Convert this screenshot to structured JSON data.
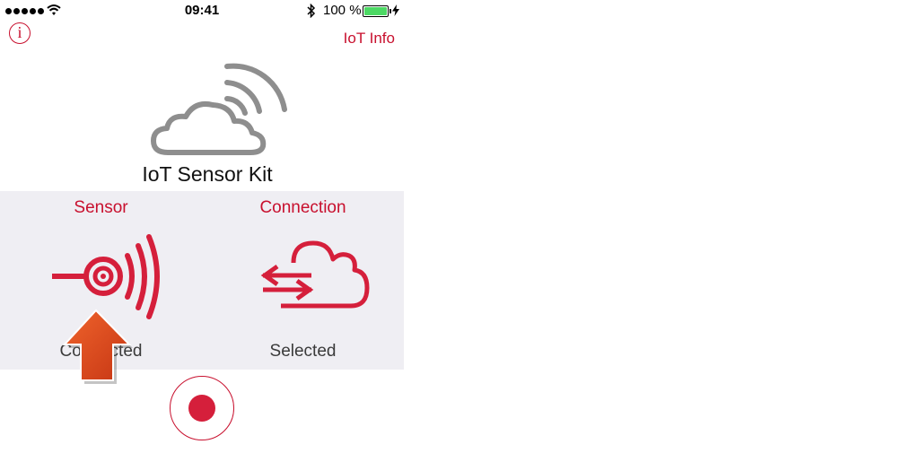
{
  "status_bar": {
    "time": "09:41",
    "battery": "100 %",
    "icons": [
      "signal-dots-icon",
      "wifi-icon",
      "bluetooth-icon",
      "battery-icon",
      "charging-icon"
    ]
  },
  "nav": {
    "info_symbol": "i",
    "right_link": "IoT Info"
  },
  "app": {
    "title": "IoT Sensor Kit",
    "logo_icon": "cloud-signal-icon"
  },
  "panel": {
    "sensor": {
      "heading": "Sensor",
      "state": "Connected",
      "icon": "sensor-signal-icon"
    },
    "connection": {
      "heading": "Connection",
      "state": "Selected",
      "icon": "cloud-transfer-icon"
    }
  },
  "overlay": {
    "icon": "up-arrow-icon",
    "color": "#d9421c"
  },
  "record": {
    "icon": "record-dot-icon"
  },
  "colors": {
    "accent": "#c8102e",
    "panel_bg": "#efeef3",
    "record": "#d51f3b"
  }
}
